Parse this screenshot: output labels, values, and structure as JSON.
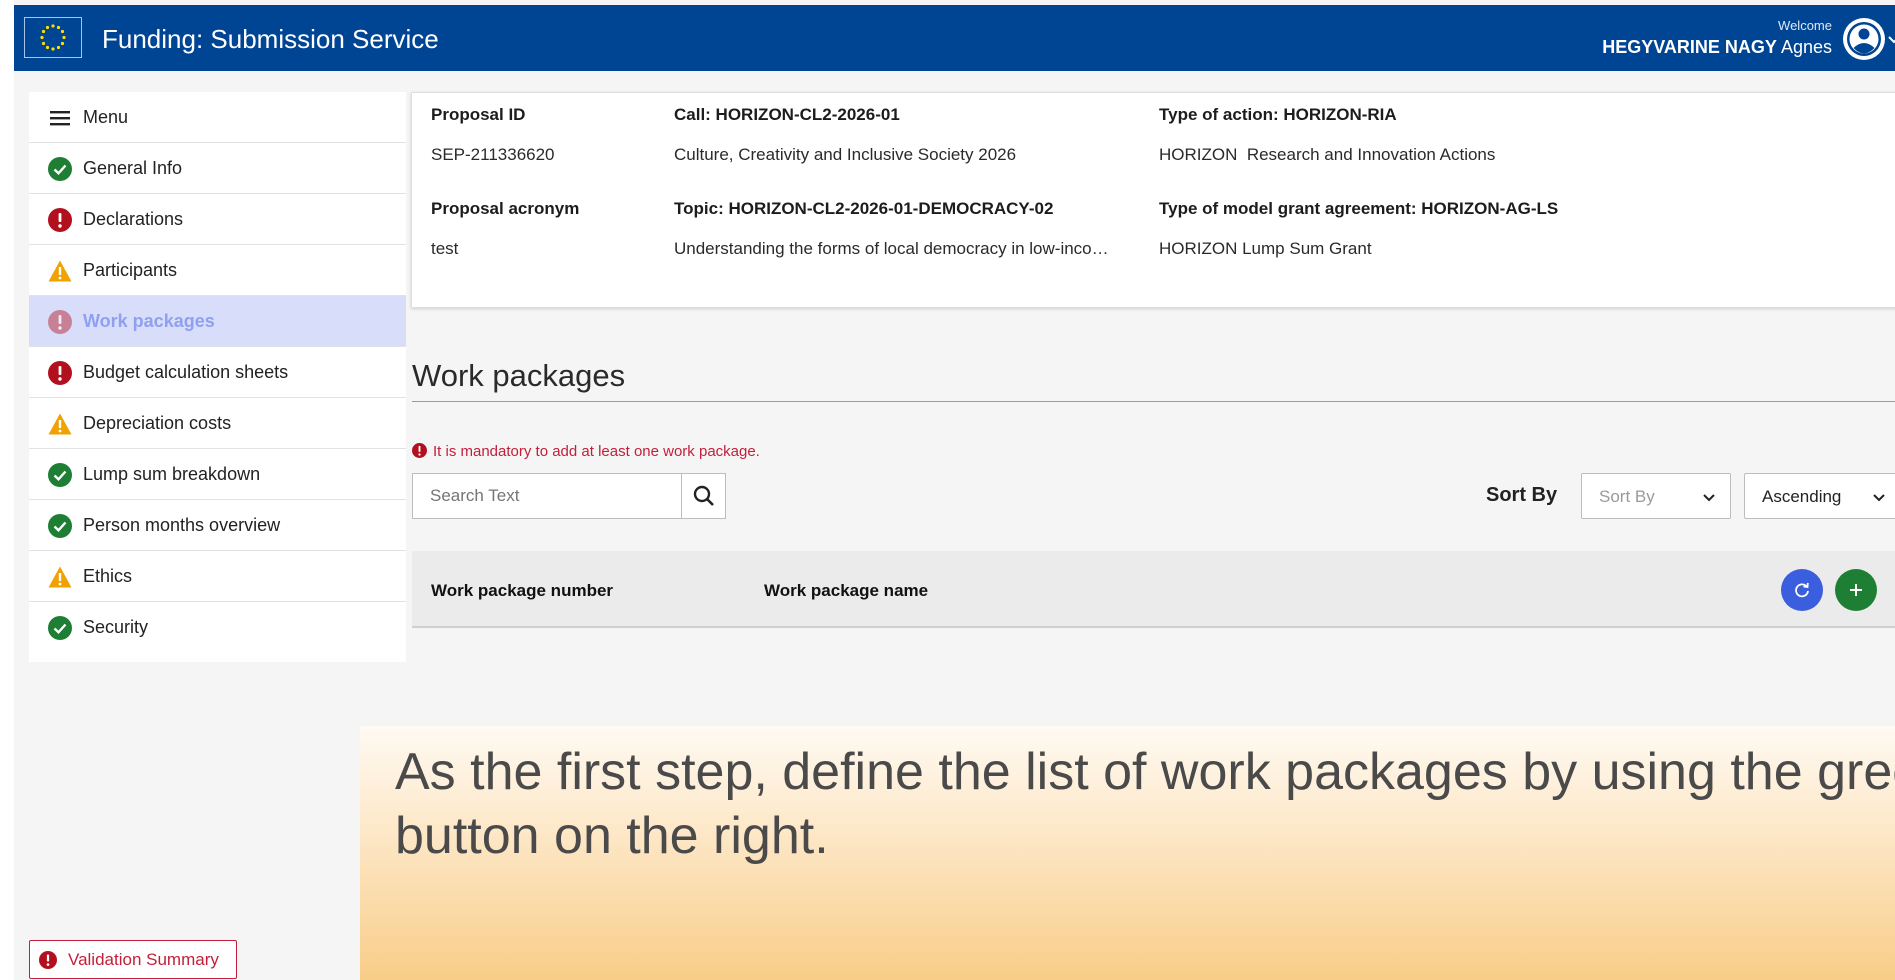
{
  "header": {
    "title": "Funding: Submission Service",
    "welcome": "Welcome",
    "user_last": "HEGYVARINE NAGY",
    "user_first": "Agnes"
  },
  "sidebar": {
    "items": [
      {
        "label": "Menu",
        "icon": "menu-icon"
      },
      {
        "label": "General Info",
        "icon": "check-circle-icon",
        "status": "complete"
      },
      {
        "label": "Declarations",
        "icon": "error-circle-icon",
        "status": "error"
      },
      {
        "label": "Participants",
        "icon": "warning-triangle-icon",
        "status": "warning"
      },
      {
        "label": "Work packages",
        "icon": "error-circle-icon",
        "status": "error",
        "active": true
      },
      {
        "label": "Budget calculation sheets",
        "icon": "error-circle-icon",
        "status": "error"
      },
      {
        "label": "Depreciation costs",
        "icon": "warning-triangle-icon",
        "status": "warning"
      },
      {
        "label": "Lump sum breakdown",
        "icon": "check-circle-icon",
        "status": "complete"
      },
      {
        "label": "Person months overview",
        "icon": "check-circle-icon",
        "status": "complete"
      },
      {
        "label": "Ethics",
        "icon": "warning-triangle-icon",
        "status": "warning"
      },
      {
        "label": "Security",
        "icon": "check-circle-icon",
        "status": "complete"
      }
    ]
  },
  "info": {
    "proposal_id_label": "Proposal ID",
    "proposal_id": "SEP-211336620",
    "acronym_label": "Proposal acronym",
    "acronym": "test",
    "call_label": "Call: HORIZON-CL2-2026-01",
    "call_value": "Culture, Creativity and Inclusive Society 2026",
    "topic_label": "Topic: HORIZON-CL2-2026-01-DEMOCRACY-02",
    "topic_value": "Understanding the forms of local democracy in low-inco…",
    "action_label": "Type of action: HORIZON-RIA",
    "action_value": "HORIZON  Research and Innovation Actions",
    "mga_label": "Type of model grant agreement: HORIZON-AG-LS",
    "mga_value": "HORIZON Lump Sum Grant"
  },
  "main": {
    "section_title": "Work packages",
    "error_message": "It is mandatory to add at least one work package.",
    "search_placeholder": "Search Text",
    "sort_label": "Sort By",
    "sort_placeholder": "Sort By",
    "order_value": "Ascending",
    "col_number": "Work package number",
    "col_name": "Work package name"
  },
  "banner": {
    "text": "As the first step, define the list of work packages by using the green button on the right."
  },
  "footer": {
    "validation_summary": "Validation Summary"
  },
  "colors": {
    "header_bg": "#004494",
    "error": "#c41e3a",
    "warning": "#f0a202",
    "success": "#1e7e34",
    "active_bg": "#d8defa",
    "refresh_btn": "#3b5ede"
  }
}
